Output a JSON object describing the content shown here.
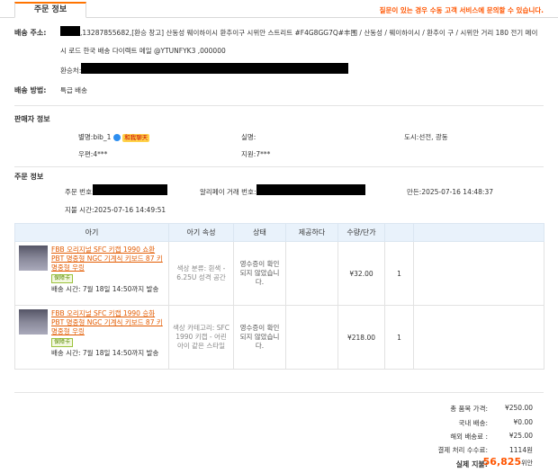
{
  "tab_title": "주문 정보",
  "notice": "질문이 있는 경우 수동 고객 서비스에 문의할 수 있습니다.",
  "shipping": {
    "address_label": "배송 주소:",
    "address_line1": ",13287855682,[환승 창고] 산동성 웨이하이시 환추이구 시위안 스트리트 #F4G8GG7Q#丰围 / 산동성 / 웨이하이시 / 환추이 구 / 시위안 거리 180 전기 메이",
    "address_line2": "시 로드 한국 배송 다이렉트 메일 @YTUNFYK3 ,000000",
    "recipient_label": "환승처:",
    "method_label": "배송 방법:",
    "method_value": "특급 배송"
  },
  "seller": {
    "section_title": "판매자 정보",
    "nickname": "별명:bib_1",
    "nickname_badge": "和我聊天",
    "realname": "실명:",
    "city": "도시:선전, 광동",
    "postcode": "우편:4***",
    "staff": "지원:7***"
  },
  "order": {
    "section_title": "주문 정보",
    "order_no_label": "주문 번호:",
    "alipay_label": "알리페이 거래 번호:",
    "created": "만든:2025-07-16 14:48:37",
    "paid": "지불 시간:2025-07-16 14:49:51"
  },
  "table": {
    "headers": [
      "아기",
      "아기 속성",
      "상태",
      "제공하다",
      "수량/단가"
    ],
    "rows": [
      {
        "title": "FBB 오리지널 SFC 키캡 1990 쇼환 PBT 명중형 NGC 기계식 키보드 87 키 명중형 우링",
        "tag": "保障卡",
        "ship": "배송 시간: 7월 18일 14:50까지 발송",
        "attr": "색상 분류: 흰색 - 6.25U 성격 공간",
        "status": "영수증이 확인되지 않았습니다.",
        "offer": "",
        "price": "¥32.00",
        "qty": "1"
      },
      {
        "title": "FBB 오리지널 SFC 키캡 1990 승화 PBT 명중형 NGC 기계식 키보드 87 키 명중형 우링",
        "tag": "保障卡",
        "ship": "배송 시간: 7월 18일 14:50까지 발송",
        "attr": "색상 카테고리: SFC 1990 키캡 - 어린아이 같은 스타일",
        "status": "영수증이 확인되지 않았습니다.",
        "offer": "",
        "price": "¥218.00",
        "qty": "1"
      }
    ]
  },
  "summary": {
    "total_label": "총 품목 가격:",
    "total_value": "¥250.00",
    "domestic_label": "국내 배송:",
    "domestic_value": "¥0.00",
    "overseas_label": "해외 배송료 :",
    "overseas_value": "¥25.00",
    "fee_label": "결제 처리 수수료:",
    "fee_value": "1114원",
    "paid_label": "실제 지불:",
    "paid_value": "56,825",
    "paid_unit": "위안"
  },
  "colors": {
    "accent": "#ff5500",
    "header_bg": "#e9f2fb",
    "link": "#e35b00"
  }
}
